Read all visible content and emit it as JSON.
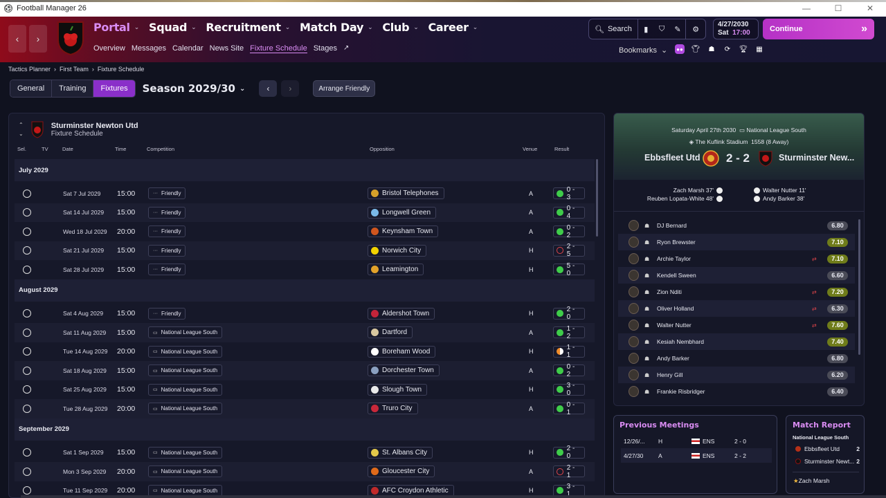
{
  "window": {
    "title": "Football Manager 26"
  },
  "nav": {
    "back_icon": "chevron-left",
    "forward_icon": "chevron-right",
    "crest_text": "S.N.F.C",
    "main": [
      {
        "label": "Portal",
        "active": true
      },
      {
        "label": "Squad"
      },
      {
        "label": "Recruitment"
      },
      {
        "label": "Match Day"
      },
      {
        "label": "Club"
      },
      {
        "label": "Career"
      }
    ],
    "sub": [
      "Overview",
      "Messages",
      "Calendar",
      "News Site",
      "Fixture Schedule",
      "Stages"
    ],
    "sub_active": "Fixture Schedule",
    "search_label": "Search",
    "date": "4/27/2030",
    "day": "Sat",
    "time": "17:00",
    "continue_label": "Continue",
    "bookmarks_label": "Bookmarks"
  },
  "breadcrumb": [
    "Tactics Planner",
    "First Team",
    "Fixture Schedule"
  ],
  "toolbar": {
    "tabs": [
      "General",
      "Training",
      "Fixtures"
    ],
    "active_tab": "Fixtures",
    "season": "Season 2029/30",
    "arrange_label": "Arrange Friendly"
  },
  "schedule": {
    "team_name": "Sturminster Newton Utd",
    "subtitle": "Fixture Schedule",
    "columns": {
      "sel": "Sel.",
      "tv": "TV",
      "date": "Date",
      "time": "Time",
      "competition": "Competition",
      "opposition": "Opposition",
      "venue": "Venue",
      "result": "Result"
    },
    "months": [
      {
        "label": "July 2029",
        "fixtures": [
          {
            "date": "Sat 7 Jul 2029",
            "time": "15:00",
            "comp": "Friendly",
            "opp": "Bristol Telephones",
            "venue": "A",
            "result": "0 - 3",
            "outcome": "W",
            "opp_color": "#d6a12a"
          },
          {
            "date": "Sat 14 Jul 2029",
            "time": "15:00",
            "comp": "Friendly",
            "opp": "Longwell Green",
            "venue": "A",
            "result": "0 - 4",
            "outcome": "W",
            "opp_color": "#7ab9e8"
          },
          {
            "date": "Wed 18 Jul 2029",
            "time": "20:00",
            "comp": "Friendly",
            "opp": "Keynsham Town",
            "venue": "A",
            "result": "0 - 2",
            "outcome": "W",
            "opp_color": "#d0561e"
          },
          {
            "date": "Sat 21 Jul 2029",
            "time": "15:00",
            "comp": "Friendly",
            "opp": "Norwich City",
            "venue": "H",
            "result": "2 - 5",
            "outcome": "L",
            "opp_color": "#f2d200"
          },
          {
            "date": "Sat 28 Jul 2029",
            "time": "15:00",
            "comp": "Friendly",
            "opp": "Leamington",
            "venue": "H",
            "result": "5 - 0",
            "outcome": "W",
            "opp_color": "#e2a22a"
          }
        ]
      },
      {
        "label": "August 2029",
        "fixtures": [
          {
            "date": "Sat 4 Aug 2029",
            "time": "15:00",
            "comp": "Friendly",
            "opp": "Aldershot Town",
            "venue": "H",
            "result": "2 - 0",
            "outcome": "W",
            "opp_color": "#c3243a"
          },
          {
            "date": "Sat 11 Aug 2029",
            "time": "15:00",
            "comp": "National League South",
            "opp": "Dartford",
            "venue": "A",
            "result": "1 - 2",
            "outcome": "W",
            "opp_color": "#d8c7a0"
          },
          {
            "date": "Tue 14 Aug 2029",
            "time": "20:00",
            "comp": "National League South",
            "opp": "Boreham Wood",
            "venue": "H",
            "result": "1 - 1",
            "outcome": "D",
            "opp_color": "#ffffff"
          },
          {
            "date": "Sat 18 Aug 2029",
            "time": "15:00",
            "comp": "National League South",
            "opp": "Dorchester Town",
            "venue": "A",
            "result": "0 - 2",
            "outcome": "W",
            "opp_color": "#8aa0c0"
          },
          {
            "date": "Sat 25 Aug 2029",
            "time": "15:00",
            "comp": "National League South",
            "opp": "Slough Town",
            "venue": "H",
            "result": "3 - 0",
            "outcome": "W",
            "opp_color": "#e9e9e9"
          },
          {
            "date": "Tue 28 Aug 2029",
            "time": "20:00",
            "comp": "National League South",
            "opp": "Truro City",
            "venue": "A",
            "result": "0 - 1",
            "outcome": "W",
            "opp_color": "#c8283a"
          }
        ]
      },
      {
        "label": "September 2029",
        "fixtures": [
          {
            "date": "Sat 1 Sep 2029",
            "time": "15:00",
            "comp": "National League South",
            "opp": "St. Albans City",
            "venue": "H",
            "result": "2 - 0",
            "outcome": "W",
            "opp_color": "#e3c84a"
          },
          {
            "date": "Mon 3 Sep 2029",
            "time": "20:00",
            "comp": "National League South",
            "opp": "Gloucester City",
            "venue": "A",
            "result": "2 - 1",
            "outcome": "L",
            "opp_color": "#e06a1a"
          },
          {
            "date": "Tue 11 Sep 2029",
            "time": "20:00",
            "comp": "National League South",
            "opp": "AFC Croydon Athletic",
            "venue": "H",
            "result": "3 - 1",
            "outcome": "W",
            "opp_color": "#c02a2a"
          }
        ]
      }
    ]
  },
  "match": {
    "date_line": "Saturday April 27th 2030",
    "competition": "National League South",
    "stadium": "The Kuflink Stadium",
    "attendance": "1558",
    "attendance_note": "(8 Away)",
    "home": "Ebbsfleet Utd",
    "away": "Sturminster New...",
    "score": "2 - 2",
    "home_scorers": [
      "Zach Marsh 37'",
      "Reuben Lopata-White 48'"
    ],
    "away_scorers": [
      "Walter Nutter 11'",
      "Andy Barker 38'"
    ],
    "players": [
      {
        "name": "DJ Bernard",
        "rating": "6.80",
        "good": false,
        "sub": false
      },
      {
        "name": "Ryon Brewster",
        "rating": "7.10",
        "good": true,
        "sub": false
      },
      {
        "name": "Archie Taylor",
        "rating": "7.10",
        "good": true,
        "sub": true
      },
      {
        "name": "Kendell Sween",
        "rating": "6.60",
        "good": false,
        "sub": false
      },
      {
        "name": "Zion Nditi",
        "rating": "7.20",
        "good": true,
        "sub": true
      },
      {
        "name": "Oliver Holland",
        "rating": "6.30",
        "good": false,
        "sub": true
      },
      {
        "name": "Walter Nutter",
        "rating": "7.60",
        "good": true,
        "sub": true
      },
      {
        "name": "Kesiah Nembhard",
        "rating": "7.40",
        "good": true,
        "sub": false
      },
      {
        "name": "Andy Barker",
        "rating": "6.80",
        "good": false,
        "sub": false
      },
      {
        "name": "Henry Gill",
        "rating": "6.20",
        "good": false,
        "sub": false
      },
      {
        "name": "Frankie Risbridger",
        "rating": "6.40",
        "good": false,
        "sub": false
      }
    ]
  },
  "previous": {
    "title": "Previous Meetings",
    "rows": [
      {
        "date": "12/26/...",
        "venue": "H",
        "comp": "ENS",
        "result": "2 - 0",
        "outcome": "W"
      },
      {
        "date": "4/27/30",
        "venue": "A",
        "comp": "ENS",
        "result": "2 - 2",
        "outcome": "D"
      }
    ]
  },
  "report": {
    "title": "Match Report",
    "league": "National League South",
    "home": "Ebbsfleet Utd",
    "home_score": "2",
    "away": "Sturminster Newt...",
    "away_score": "2",
    "pom": "Zach Marsh"
  }
}
